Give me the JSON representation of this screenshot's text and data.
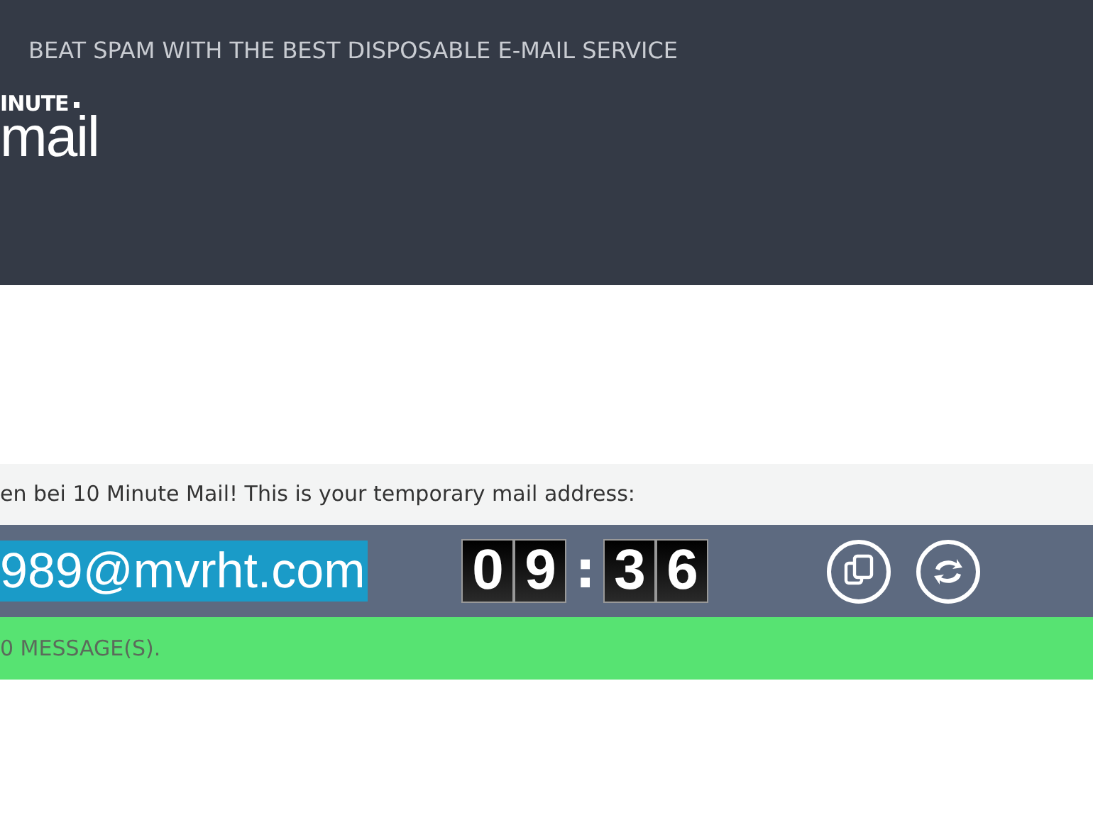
{
  "header": {
    "tagline": "BEAT SPAM WITH THE BEST DISPOSABLE E-MAIL SERVICE",
    "logo": {
      "top": "INUTE",
      "bottom": "mail"
    }
  },
  "welcome": "en bei 10 Minute Mail! This is your temporary mail address:",
  "address": {
    "value": "989@mvrht.com",
    "selected": true
  },
  "timer": {
    "minutes": [
      "0",
      "9"
    ],
    "separator": ":",
    "seconds": [
      "3",
      "6"
    ]
  },
  "actions": [
    {
      "kind": "copy"
    },
    {
      "kind": "refresh"
    }
  ],
  "messages": "0 MESSAGE(S)."
}
